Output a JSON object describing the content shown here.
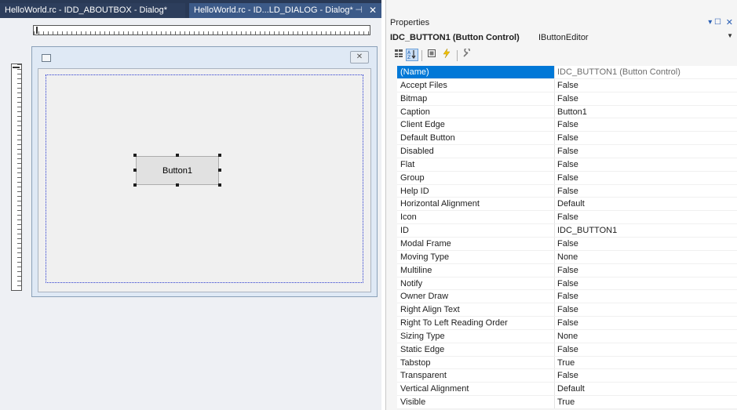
{
  "editor": {
    "tabs": [
      {
        "label": "HelloWorld.rc - IDD_ABOUTBOX - Dialog*"
      },
      {
        "label": "HelloWorld.rc - ID...LD_DIALOG - Dialog*"
      }
    ],
    "tab_pin_icon": "⊣",
    "tab_close_icon": "✕",
    "dialog": {
      "button_caption": "Button1",
      "close_glyph": "✕"
    }
  },
  "properties": {
    "title": "Properties",
    "pin_glyph": "▾ ☐",
    "close_glyph": "✕",
    "object_name": "IDC_BUTTON1 (Button Control)",
    "object_type": "IButtonEditor",
    "toolbar": [
      "categorized-icon",
      "alphabetical-icon",
      "property-pages-icon",
      "events-icon",
      "property-wrench-icon"
    ],
    "rows": [
      {
        "name": "(Name)",
        "value": "IDC_BUTTON1 (Button Control)"
      },
      {
        "name": "Accept Files",
        "value": "False"
      },
      {
        "name": "Bitmap",
        "value": "False"
      },
      {
        "name": "Caption",
        "value": "Button1"
      },
      {
        "name": "Client Edge",
        "value": "False"
      },
      {
        "name": "Default Button",
        "value": "False"
      },
      {
        "name": "Disabled",
        "value": "False"
      },
      {
        "name": "Flat",
        "value": "False"
      },
      {
        "name": "Group",
        "value": "False"
      },
      {
        "name": "Help ID",
        "value": "False"
      },
      {
        "name": "Horizontal Alignment",
        "value": "Default"
      },
      {
        "name": "Icon",
        "value": "False"
      },
      {
        "name": "ID",
        "value": "IDC_BUTTON1"
      },
      {
        "name": "Modal Frame",
        "value": "False"
      },
      {
        "name": "Moving Type",
        "value": "None"
      },
      {
        "name": "Multiline",
        "value": "False"
      },
      {
        "name": "Notify",
        "value": "False"
      },
      {
        "name": "Owner Draw",
        "value": "False"
      },
      {
        "name": "Right Align Text",
        "value": "False"
      },
      {
        "name": "Right To Left Reading Order",
        "value": "False"
      },
      {
        "name": "Sizing Type",
        "value": "None"
      },
      {
        "name": "Static Edge",
        "value": "False"
      },
      {
        "name": "Tabstop",
        "value": "True"
      },
      {
        "name": "Transparent",
        "value": "False"
      },
      {
        "name": "Vertical Alignment",
        "value": "Default"
      },
      {
        "name": "Visible",
        "value": "True"
      }
    ]
  },
  "colors": {
    "tab_bar": "#293955",
    "active_tab": "#3c5a88",
    "selection": "#0078d7",
    "guide": "#2b3bd0"
  }
}
